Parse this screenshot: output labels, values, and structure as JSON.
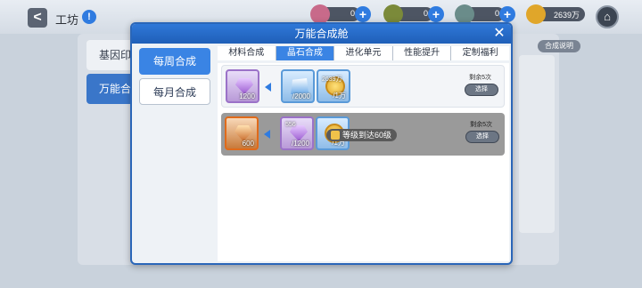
{
  "topbar": {
    "back_label": "<",
    "title": "工坊",
    "help_label": "!",
    "resources": [
      {
        "icon": "feather-icon",
        "value": "0",
        "color": "#c86a8a"
      },
      {
        "icon": "bag-icon",
        "value": "0",
        "color": "#7b8a3a"
      },
      {
        "icon": "gear-token-icon",
        "value": "0",
        "color": "#6a8c8a"
      },
      {
        "icon": "gold-coin-icon",
        "value": "2639万",
        "color": "#e0a62a"
      }
    ],
    "plus_label": "+",
    "home_label": "⌂"
  },
  "background": {
    "tabs": [
      "基因印",
      "万能合"
    ],
    "right_button": "合成说明"
  },
  "modal": {
    "title": "万能合成舱",
    "close_label": "✕",
    "side_tabs": [
      "每周合成",
      "每月合成"
    ],
    "tabs": [
      "材料合成",
      "晶石合成",
      "进化单元",
      "性能提升",
      "定制福利"
    ],
    "active_tab_index": 1,
    "recipes": [
      {
        "output": {
          "qty": "1200"
        },
        "inputs": [
          {
            "qty": "/2000",
            "type": "card"
          },
          {
            "label": "2639万",
            "qty": "/1万",
            "type": "coin"
          }
        ],
        "remain": "剩余5次",
        "button": "选择"
      },
      {
        "output": {
          "qty": "600"
        },
        "inputs": [
          {
            "label": "556",
            "qty": "/1200",
            "type": "gem"
          },
          {
            "label": "",
            "qty": "/1万",
            "type": "coin"
          }
        ],
        "lock_text": "等级到达60级",
        "remain": "剩余5次",
        "button": "选择"
      }
    ]
  }
}
